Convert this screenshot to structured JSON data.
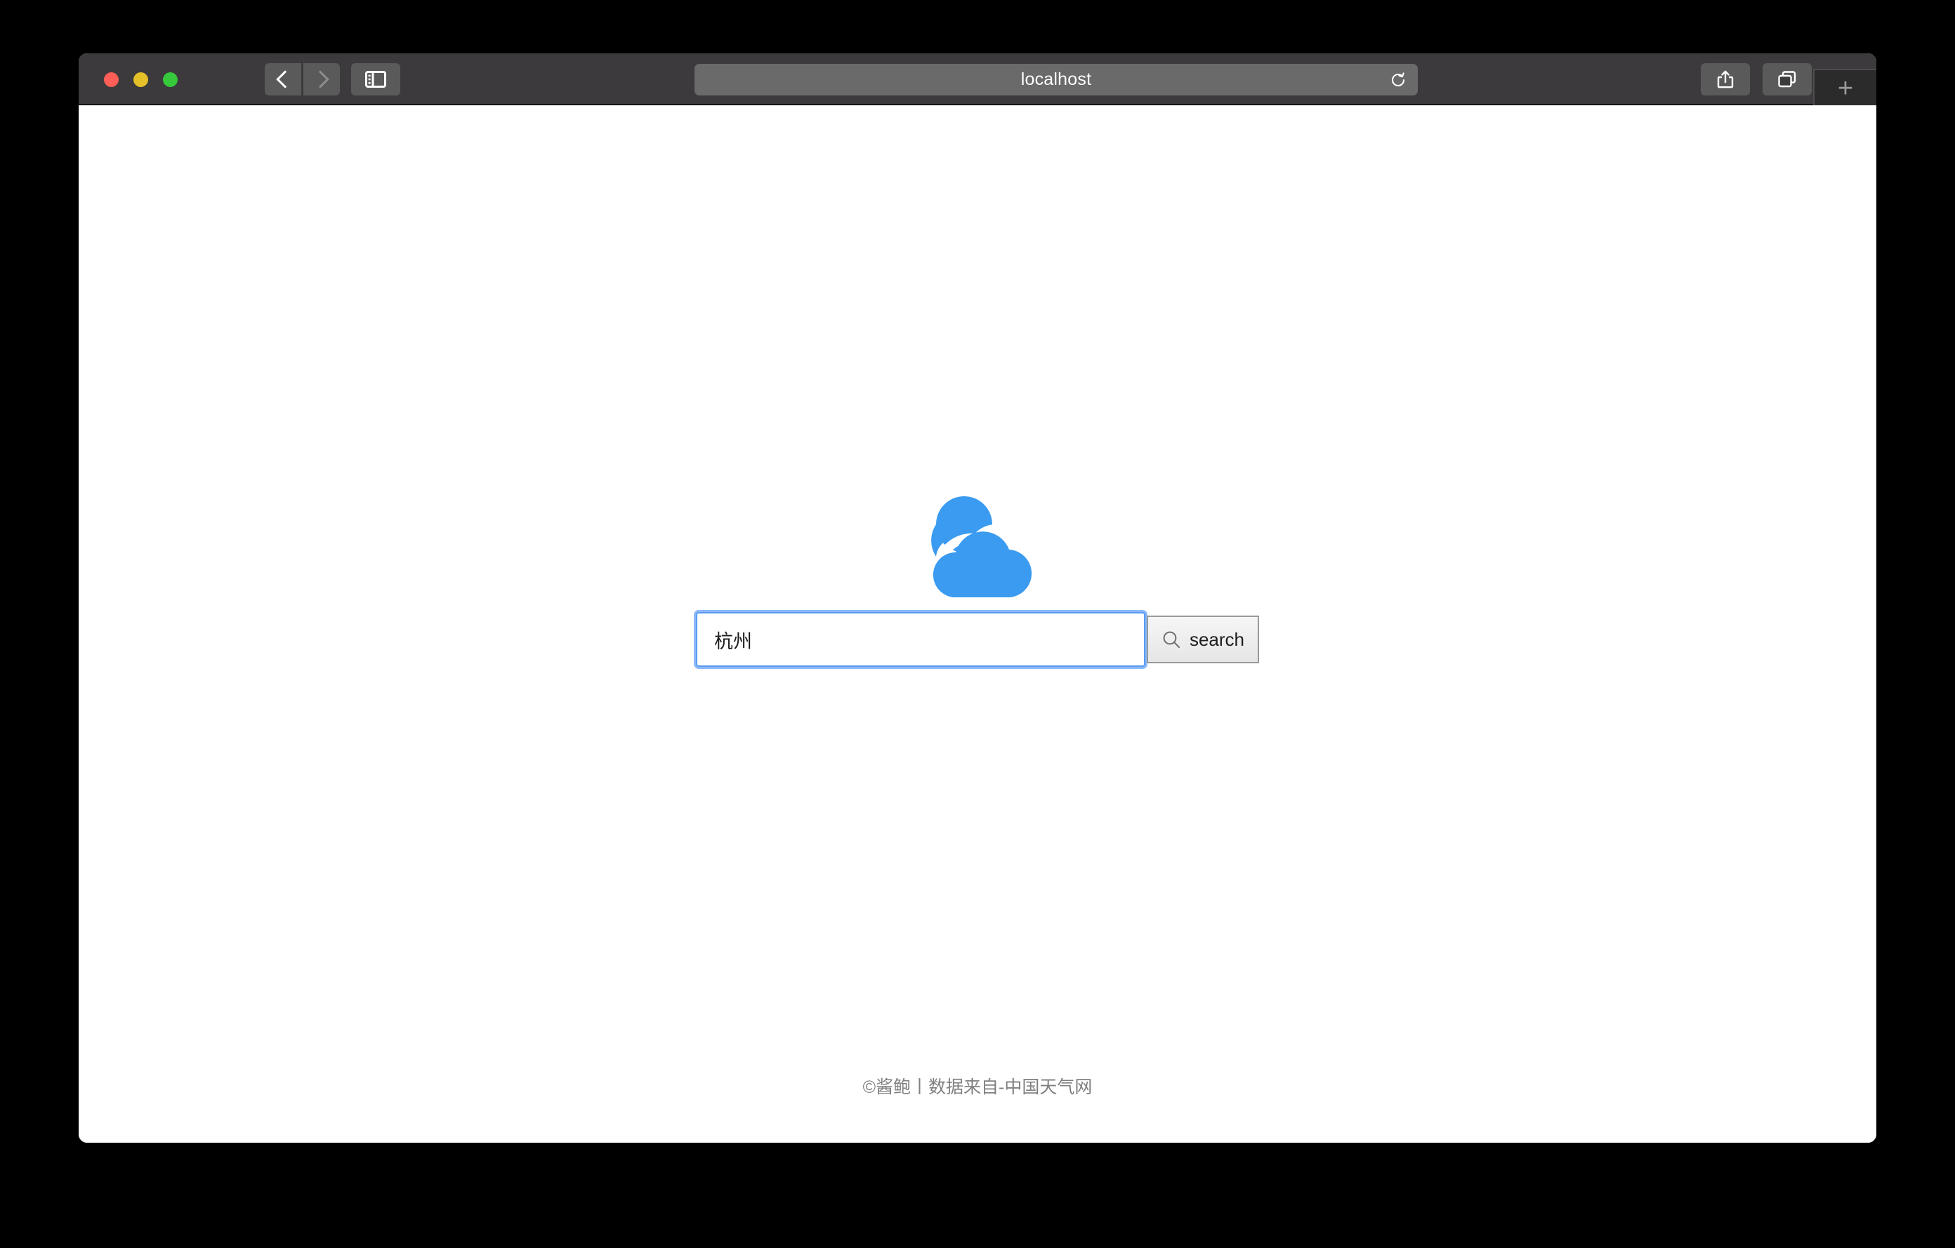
{
  "browser": {
    "window_controls": {
      "close_label": "close",
      "minimize_label": "minimize",
      "maximize_label": "maximize"
    },
    "nav": {
      "back_label": "Back",
      "forward_label": "Forward",
      "sidebar_label": "Show Sidebar"
    },
    "address_bar": {
      "url": "localhost",
      "reload_label": "Reload"
    },
    "toolbar_right": {
      "share_label": "Share",
      "tab_overview_label": "Tab Overview",
      "new_tab_label": "+"
    },
    "colors": {
      "toolbar_bg": "#3c3a3c",
      "url_bar_bg": "#6a6a6a",
      "button_bg": "#5b5a5b",
      "close_dot": "#ff5f57",
      "minimize_dot": "#e6c029",
      "maximize_dot": "#36c93b"
    }
  },
  "page": {
    "logo": {
      "icon": "cloud-logo-icon",
      "color": "#3a9bf0"
    },
    "search": {
      "icon": "search-icon",
      "input_value": "杭州",
      "input_placeholder": "",
      "button_label": "search"
    },
    "footer": {
      "text": "©酱鲍丨数据来自-中国天气网"
    }
  }
}
